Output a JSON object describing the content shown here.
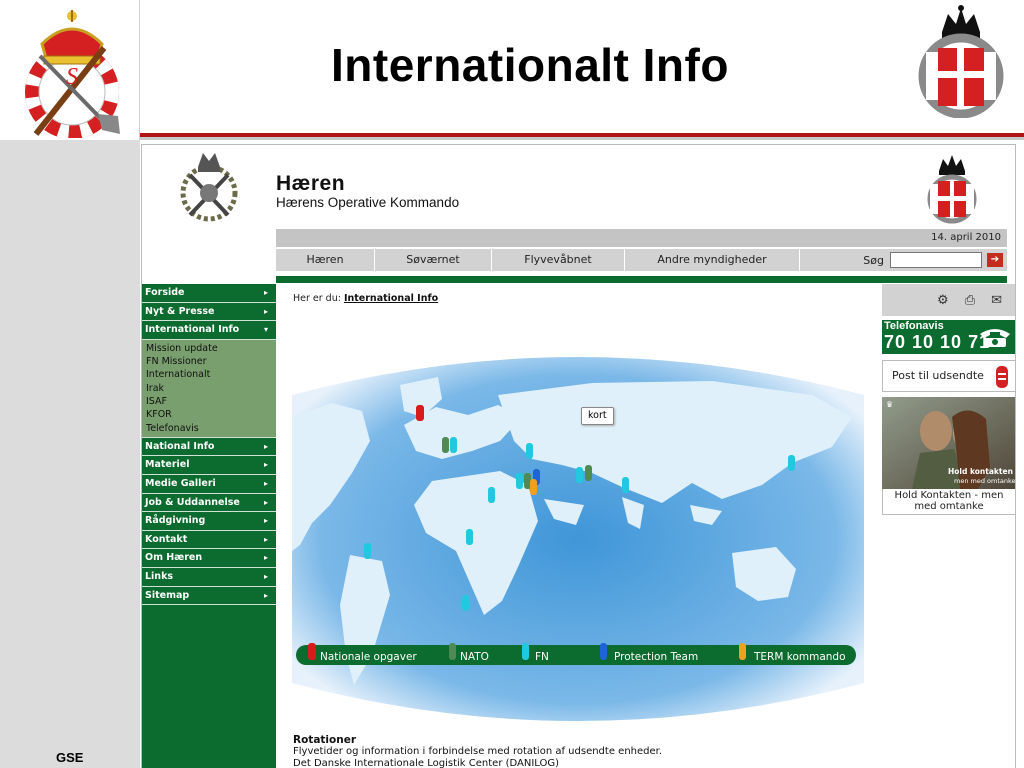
{
  "slide": {
    "title": "Internationalt Info",
    "footer": "GSE"
  },
  "web": {
    "brand_name": "Hæren",
    "brand_sub": "Hærens Operative Kommando",
    "date": "14. april 2010",
    "nav": [
      "Hæren",
      "Søværnet",
      "Flyvevåbnet",
      "Andre myndigheder"
    ],
    "search_label": "Søg",
    "go_icon": "arrow-right-icon",
    "sidebar": {
      "items": [
        {
          "label": "Forside"
        },
        {
          "label": "Nyt & Presse"
        },
        {
          "label": "International Info"
        },
        {
          "label": "National Info"
        },
        {
          "label": "Materiel"
        },
        {
          "label": "Medie Galleri"
        },
        {
          "label": "Job & Uddannelse"
        },
        {
          "label": "Rådgivning"
        },
        {
          "label": "Kontakt"
        },
        {
          "label": "Om Hæren"
        },
        {
          "label": "Links"
        },
        {
          "label": "Sitemap"
        }
      ],
      "subitems": [
        "Mission update",
        "FN Missioner",
        "Internationalt",
        "Irak",
        "ISAF",
        "KFOR",
        "Telefonavis"
      ]
    },
    "breadcrumb": {
      "prefix": "Her er du:",
      "current": "International Info"
    },
    "map": {
      "kort_label": "kort",
      "legend": [
        {
          "label": "Nationale opgaver",
          "color": "#d81b1b"
        },
        {
          "label": "NATO",
          "color": "#4f8a55"
        },
        {
          "label": "FN",
          "color": "#20c8e0"
        },
        {
          "label": "Protection Team",
          "color": "#1e64d2"
        },
        {
          "label": "TERM kommando",
          "color": "#f0a020"
        }
      ]
    },
    "rotationer": {
      "title": "Rotationer",
      "line1": "Flyvetider og information i forbindelse med rotation af udsendte enheder.",
      "line2": "Det Danske Internationale Logistik Center (DANILOG)"
    },
    "right": {
      "tools": [
        "gear-icon",
        "print-icon",
        "mail-icon"
      ],
      "telefonavis_title": "Telefonavis",
      "telefonavis_number": "70 10 10 71",
      "post_label": "Post til udsendte",
      "photo_caption1": "Hold kontakten",
      "photo_caption2": "men med omtanke",
      "photo_link": "Hold Kontakten - men med omtanke"
    }
  }
}
